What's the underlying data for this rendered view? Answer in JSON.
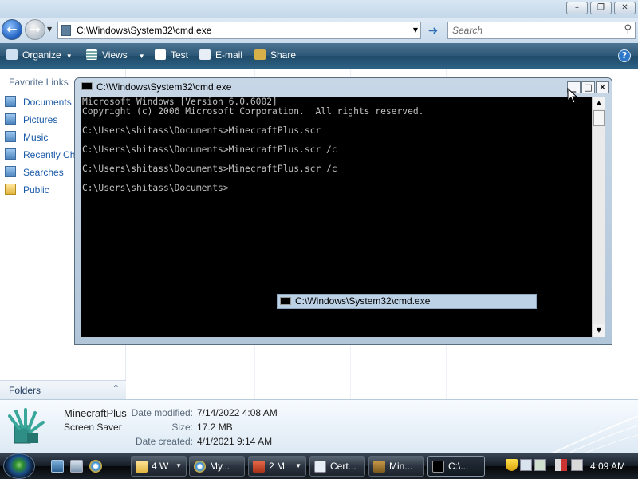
{
  "explorer": {
    "address": "C:\\Windows\\System32\\cmd.exe",
    "search_placeholder": "Search",
    "commands": {
      "organize": "Organize",
      "views": "Views",
      "test": "Test",
      "email": "E-mail",
      "share": "Share",
      "help": "?"
    },
    "nav": {
      "header": "Favorite Links",
      "items": [
        {
          "label": "Documents",
          "icon": "documents-icon"
        },
        {
          "label": "Pictures",
          "icon": "pictures-icon"
        },
        {
          "label": "Music",
          "icon": "music-icon"
        },
        {
          "label": "Recently Ch",
          "icon": "recently-changed-icon"
        },
        {
          "label": "Searches",
          "icon": "searches-icon"
        },
        {
          "label": "Public",
          "icon": "public-folder-icon"
        }
      ],
      "folders_label": "Folders"
    },
    "details": {
      "name": "MinecraftPlus",
      "type": "Screen Saver",
      "modified_label": "Date modified:",
      "modified": "7/14/2022 4:08 AM",
      "size_label": "Size:",
      "size": "17.2 MB",
      "created_label": "Date created:",
      "created": "4/1/2021 9:14 AM"
    }
  },
  "cmd": {
    "title": "C:\\Windows\\System32\\cmd.exe",
    "lines": [
      "Microsoft Windows [Version 6.0.6002]",
      "Copyright (c) 2006 Microsoft Corporation.  All rights reserved.",
      "C:\\Users\\shitass\\Documents>MinecraftPlus.scr",
      "C:\\Users\\shitass\\Documents>MinecraftPlus.scr /c",
      "C:\\Users\\shitass\\Documents>MinecraftPlus.scr /c",
      "C:\\Users\\shitass\\Documents>"
    ],
    "tooltip": "C:\\Windows\\System32\\cmd.exe"
  },
  "taskbar": {
    "buttons": [
      {
        "label": "4 W",
        "icon": "folder-icon",
        "has_menu": true
      },
      {
        "label": "My...",
        "icon": "ie-icon",
        "has_menu": false
      },
      {
        "label": "2 M",
        "icon": "toolbox-icon",
        "has_menu": true
      },
      {
        "label": "Cert...",
        "icon": "window-icon",
        "has_menu": false
      },
      {
        "label": "Min...",
        "icon": "minecraft-icon",
        "has_menu": false
      },
      {
        "label": "C:\\...",
        "icon": "cmd-icon",
        "has_menu": false
      }
    ],
    "clock": "4:09 AM"
  },
  "colors": {
    "console_bg": "#000000",
    "console_text": "#c0c0c0",
    "link": "#1a5aa8"
  }
}
